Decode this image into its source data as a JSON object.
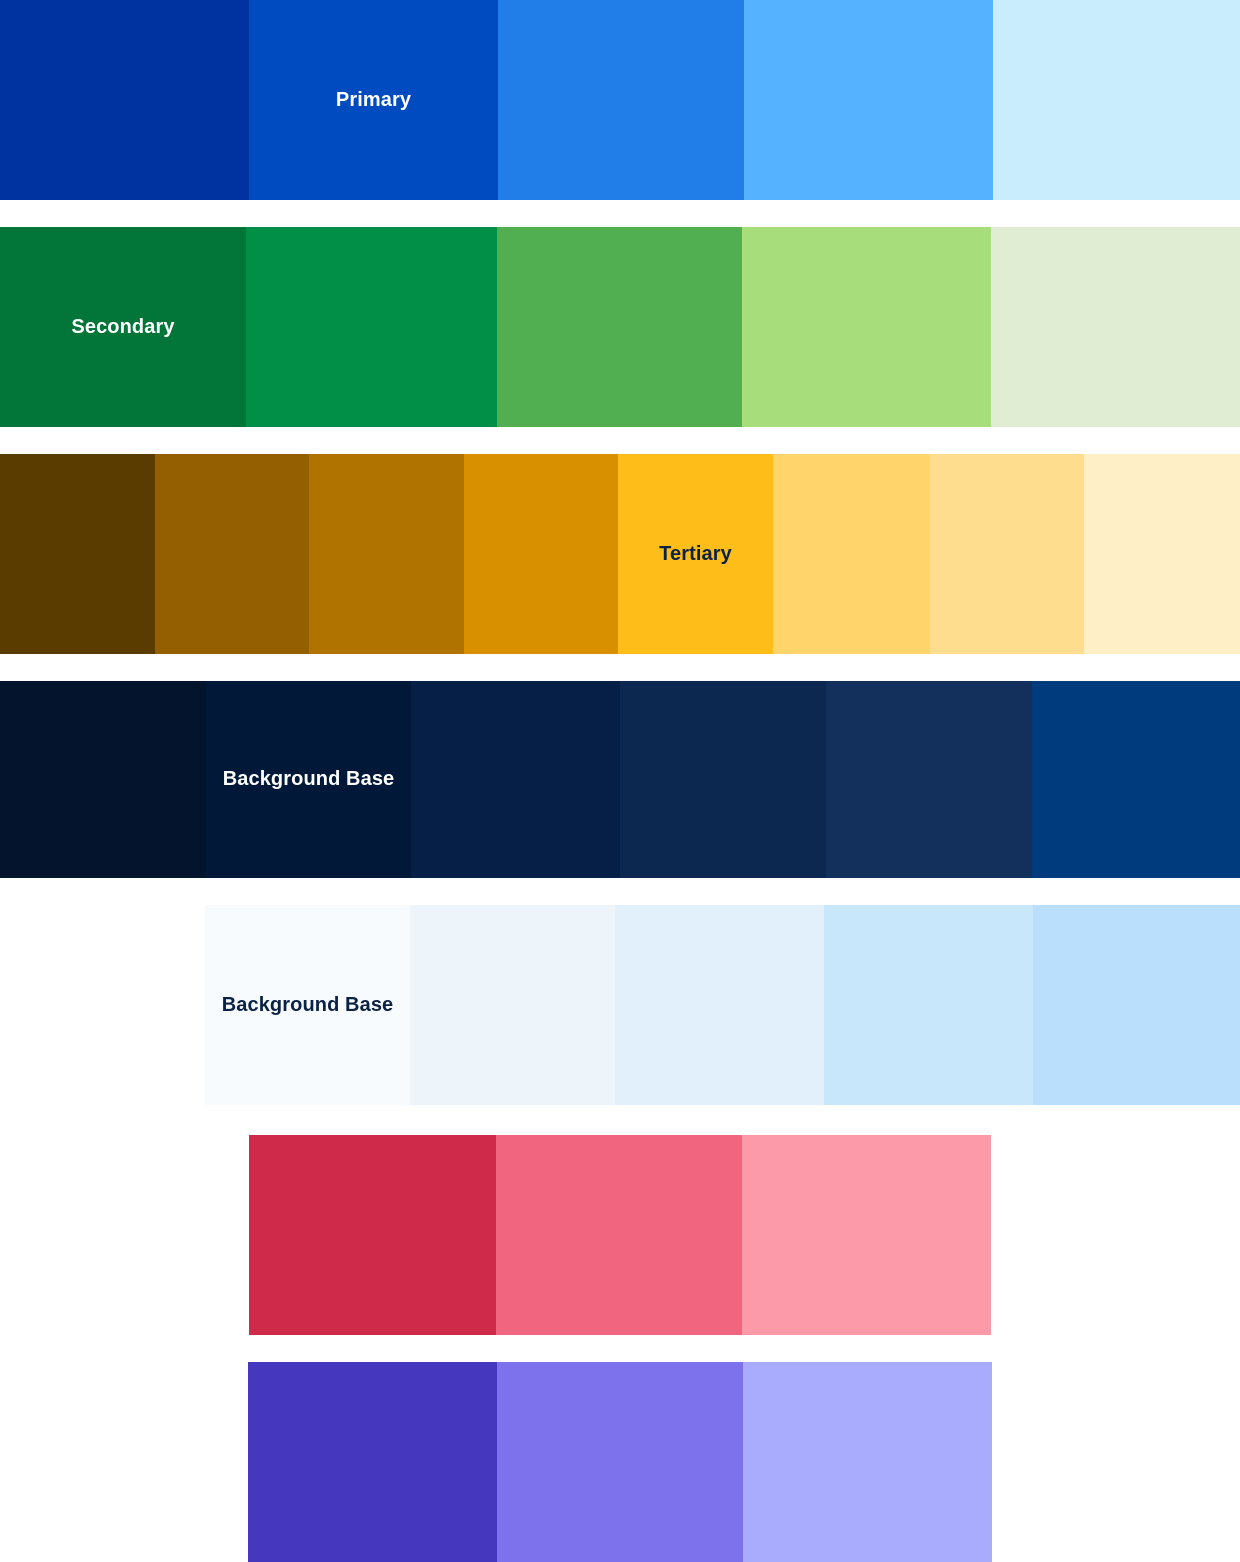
{
  "palettes": [
    {
      "id": "primary",
      "label_color": "#ffffff",
      "swatches": [
        {
          "color": "#0033a0",
          "label": ""
        },
        {
          "color": "#004bbf",
          "label": "Primary"
        },
        {
          "color": "#217ee9",
          "label": ""
        },
        {
          "color": "#54b2fe",
          "label": ""
        },
        {
          "color": "#caedfd",
          "label": ""
        }
      ]
    },
    {
      "id": "secondary",
      "label_color": "#ffffff",
      "swatches": [
        {
          "color": "#017638",
          "label": "Secondary"
        },
        {
          "color": "#018e46",
          "label": ""
        },
        {
          "color": "#51af52",
          "label": ""
        },
        {
          "color": "#a8dd7c",
          "label": ""
        },
        {
          "color": "#e0edd3",
          "label": ""
        }
      ]
    },
    {
      "id": "tertiary",
      "label_color": "#0b2244",
      "swatches": [
        {
          "color": "#5a3c00",
          "label": ""
        },
        {
          "color": "#935f00",
          "label": ""
        },
        {
          "color": "#b07300",
          "label": ""
        },
        {
          "color": "#d99000",
          "label": ""
        },
        {
          "color": "#febd18",
          "label": "Tertiary"
        },
        {
          "color": "#fed46b",
          "label": ""
        },
        {
          "color": "#fede8e",
          "label": ""
        },
        {
          "color": "#feefc6",
          "label": ""
        }
      ]
    },
    {
      "id": "background-dark",
      "label_color": "#ffffff",
      "swatches": [
        {
          "color": "#03142c",
          "label": ""
        },
        {
          "color": "#021838",
          "label": "Background Base"
        },
        {
          "color": "#061f47",
          "label": ""
        },
        {
          "color": "#0c2850",
          "label": ""
        },
        {
          "color": "#13305c",
          "label": ""
        },
        {
          "color": "#003c7d",
          "label": ""
        }
      ]
    },
    {
      "id": "background-light",
      "label_color": "#0b2244",
      "swatches": [
        {
          "color": "#f8fbfe",
          "label": "Background Base"
        },
        {
          "color": "#eef5fa",
          "label": ""
        },
        {
          "color": "#e2f0fb",
          "label": ""
        },
        {
          "color": "#c8e7fb",
          "label": ""
        },
        {
          "color": "#b9dffc",
          "label": ""
        }
      ]
    },
    {
      "id": "red",
      "label_color": "#ffffff",
      "swatches": [
        {
          "color": "#d02a4a",
          "label": ""
        },
        {
          "color": "#f2657f",
          "label": ""
        },
        {
          "color": "#fd9aaa",
          "label": ""
        }
      ]
    },
    {
      "id": "purple",
      "label_color": "#ffffff",
      "swatches": [
        {
          "color": "#4637bf",
          "label": ""
        },
        {
          "color": "#7d72ec",
          "label": ""
        },
        {
          "color": "#a9abfd",
          "label": ""
        }
      ]
    }
  ]
}
